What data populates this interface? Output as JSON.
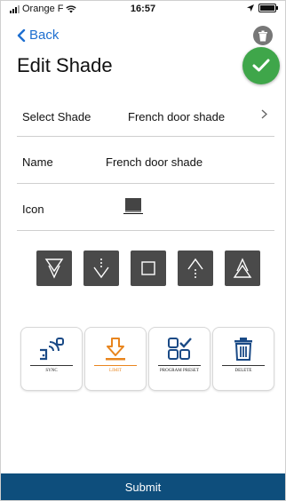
{
  "status_bar": {
    "carrier": "Orange F",
    "time": "16:57"
  },
  "nav": {
    "back_label": "Back"
  },
  "page": {
    "title": "Edit Shade"
  },
  "form": {
    "select_shade_label": "Select Shade",
    "select_shade_value": "French door shade",
    "name_label": "Name",
    "name_value": "French door shade",
    "icon_label": "Icon"
  },
  "controls": [
    {
      "name": "open-fully-icon"
    },
    {
      "name": "step-down-icon"
    },
    {
      "name": "stop-icon"
    },
    {
      "name": "step-up-icon"
    },
    {
      "name": "close-fully-icon"
    }
  ],
  "actions": {
    "sync_label": "SYNC",
    "limit_label": "LIMIT",
    "program_preset_label": "PROGRAM PRESET",
    "delete_label": "DELETE"
  },
  "footer": {
    "submit_label": "Submit"
  },
  "colors": {
    "accent_blue": "#1e6fd0",
    "confirm_green": "#3fa64a",
    "submit_bar": "#0e4e7c",
    "limit_orange": "#e8851e",
    "control_gray": "#4a4a4a"
  }
}
